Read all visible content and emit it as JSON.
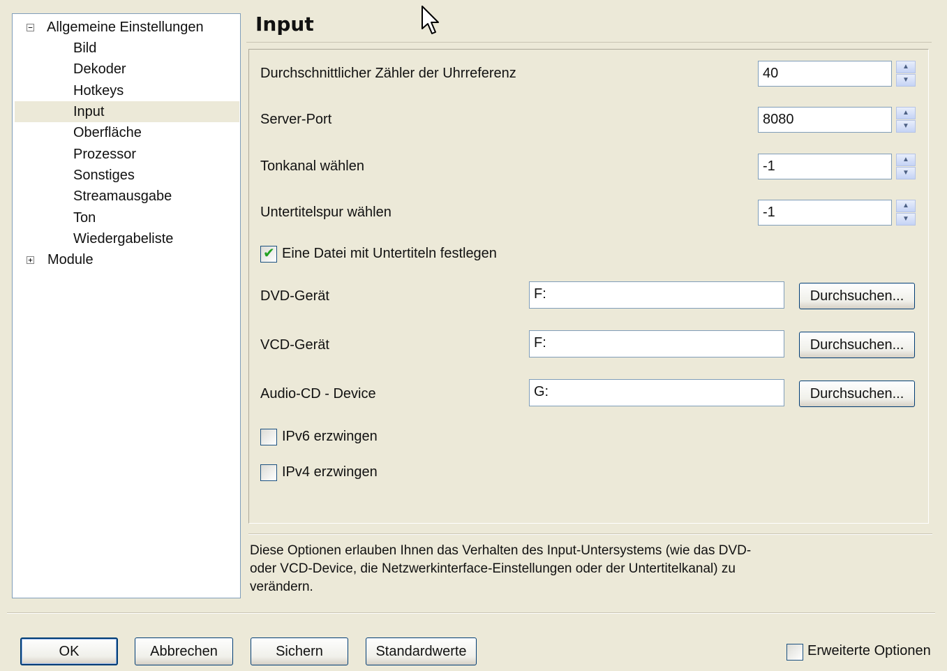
{
  "tree": {
    "root_general": "Allgemeine Einstellungen",
    "items": [
      "Bild",
      "Dekoder",
      "Hotkeys",
      "Input",
      "Oberfläche",
      "Prozessor",
      "Sonstiges",
      "Streamausgabe",
      "Ton",
      "Wiedergabeliste"
    ],
    "selected": "Input",
    "root_modules": "Module",
    "expanded_glyph": "−",
    "collapsed_glyph": "+"
  },
  "panel": {
    "title": "Input"
  },
  "fields": {
    "clock_ref_label": "Durchschnittlicher Zähler der Uhrreferenz",
    "clock_ref_value": "40",
    "server_port_label": "Server-Port",
    "server_port_value": "8080",
    "audio_channel_label": "Tonkanal wählen",
    "audio_channel_value": "-1",
    "subtitle_track_label": "Untertitelspur wählen",
    "subtitle_track_value": "-1",
    "subtitle_file_label": "Eine Datei mit Untertiteln festlegen",
    "subtitle_file_checked": true,
    "dvd_label": "DVD-Gerät",
    "dvd_value": "F:",
    "vcd_label": "VCD-Gerät",
    "vcd_value": "F:",
    "cdda_label": "Audio-CD - Device",
    "cdda_value": "G:",
    "browse_label": "Durchsuchen...",
    "ipv6_label": "IPv6 erzwingen",
    "ipv6_checked": false,
    "ipv4_label": "IPv4 erzwingen",
    "ipv4_checked": false
  },
  "description": "Diese Optionen erlauben Ihnen das Verhalten des Input-Untersystems (wie das DVD- oder VCD-Device, die Netzwerkinterface-Einstellungen oder der Untertitelkanal) zu verändern.",
  "footer": {
    "ok": "OK",
    "cancel": "Abbrechen",
    "save": "Sichern",
    "defaults": "Standardwerte",
    "advanced_label": "Erweiterte Optionen",
    "advanced_checked": false
  },
  "icons": {
    "spin_up": "▲",
    "spin_down": "▼",
    "check_mark": "✔"
  },
  "colors": {
    "window_bg": "#ece9d8",
    "field_border": "#7f9db9",
    "button_border": "#003c74",
    "check_green": "#21a121"
  }
}
